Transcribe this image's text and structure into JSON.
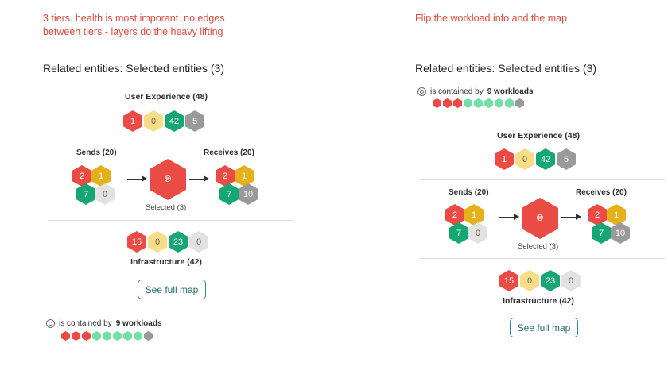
{
  "colors": {
    "red": "#ea4c45",
    "yellow": "#f7dc8a",
    "amber": "#e5b01a",
    "green": "#17a774",
    "gray": "#9a9a9a",
    "lightgray": "#e2e2e2",
    "mint": "#72dfa6",
    "note": "#e0483e",
    "button_border": "#2d8a85"
  },
  "left": {
    "note_line1": "3 tiers. health is most imporant. no edges",
    "note_line2": "between tiers - layers do the heavy lifting",
    "heading": "Related entities: Selected entities (3)",
    "user_experience": {
      "title": "User Experience (48)",
      "hexes": [
        {
          "value": "1",
          "color": "red"
        },
        {
          "value": "0",
          "color": "yellow"
        },
        {
          "value": "42",
          "color": "green"
        },
        {
          "value": "5",
          "color": "gray"
        }
      ]
    },
    "sends": {
      "title": "Sends (20)",
      "hexes": [
        {
          "value": "2",
          "color": "red"
        },
        {
          "value": "1",
          "color": "amber"
        },
        {
          "value": "7",
          "color": "green"
        },
        {
          "value": "0",
          "color": "lightgray"
        }
      ]
    },
    "receives": {
      "title": "Receives (20)",
      "hexes": [
        {
          "value": "2",
          "color": "red"
        },
        {
          "value": "1",
          "color": "amber"
        },
        {
          "value": "7",
          "color": "green"
        },
        {
          "value": "10",
          "color": "gray"
        }
      ]
    },
    "selected": {
      "label": "Selected (3)",
      "icon": "globe-icon"
    },
    "infrastructure": {
      "title": "Infrastructure (42)",
      "hexes": [
        {
          "value": "15",
          "color": "red"
        },
        {
          "value": "0",
          "color": "yellow"
        },
        {
          "value": "23",
          "color": "green"
        },
        {
          "value": "0",
          "color": "lightgray"
        }
      ]
    },
    "button": "See full map",
    "contained": {
      "prefix": "is contained by",
      "bold": "9 workloads",
      "icon": "workload-icon",
      "mini": [
        "red",
        "red",
        "red",
        "mint",
        "mint",
        "mint",
        "mint",
        "mint",
        "gray"
      ]
    }
  },
  "right": {
    "note_line1": "Flip the workload info and the map",
    "heading": "Related entities: Selected entities (3)",
    "contained": {
      "prefix": "is contained by",
      "bold": "9 workloads",
      "icon": "workload-icon",
      "mini": [
        "red",
        "red",
        "red",
        "mint",
        "mint",
        "mint",
        "mint",
        "mint",
        "gray"
      ]
    },
    "user_experience": {
      "title": "User Experience (48)",
      "hexes": [
        {
          "value": "1",
          "color": "red"
        },
        {
          "value": "0",
          "color": "yellow"
        },
        {
          "value": "42",
          "color": "green"
        },
        {
          "value": "5",
          "color": "gray"
        }
      ]
    },
    "sends": {
      "title": "Sends (20)",
      "hexes": [
        {
          "value": "2",
          "color": "red"
        },
        {
          "value": "1",
          "color": "amber"
        },
        {
          "value": "7",
          "color": "green"
        },
        {
          "value": "0",
          "color": "lightgray"
        }
      ]
    },
    "receives": {
      "title": "Receives (20)",
      "hexes": [
        {
          "value": "2",
          "color": "red"
        },
        {
          "value": "1",
          "color": "amber"
        },
        {
          "value": "7",
          "color": "green"
        },
        {
          "value": "10",
          "color": "gray"
        }
      ]
    },
    "selected": {
      "label": "Selected (3)",
      "icon": "globe-icon"
    },
    "infrastructure": {
      "title": "Infrastructure (42)",
      "hexes": [
        {
          "value": "15",
          "color": "red"
        },
        {
          "value": "0",
          "color": "yellow"
        },
        {
          "value": "23",
          "color": "green"
        },
        {
          "value": "0",
          "color": "lightgray"
        }
      ]
    },
    "button": "See full map"
  }
}
